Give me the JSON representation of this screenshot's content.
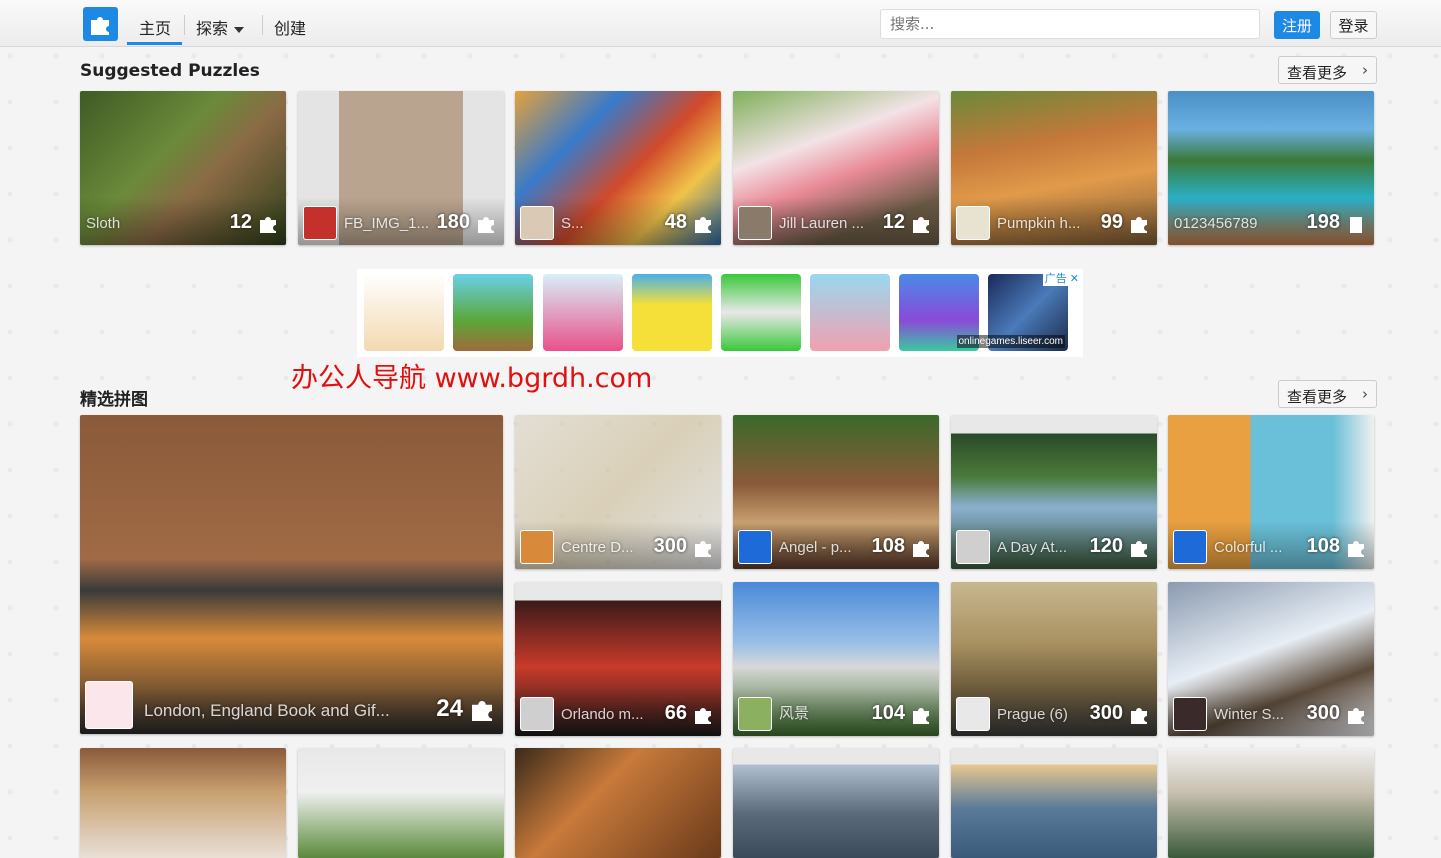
{
  "nav": {
    "home": "主页",
    "explore": "探索",
    "create": "创建",
    "search_placeholder": "搜索...",
    "register": "注册",
    "login": "登录"
  },
  "suggested": {
    "title": "Suggested Puzzles",
    "more": "查看更多",
    "tiles": [
      {
        "name": "Sloth",
        "count": "12"
      },
      {
        "name": "FB_IMG_1...",
        "count": "180"
      },
      {
        "name": "S...",
        "count": "48"
      },
      {
        "name": "Jill Lauren ...",
        "count": "12"
      },
      {
        "name": "Pumpkin h...",
        "count": "99"
      },
      {
        "name": "0123456789",
        "count": "198"
      }
    ]
  },
  "ad": {
    "tag": "广告 ✕",
    "caption": "onlinegames.liseer.com"
  },
  "watermark": "办公人导航 www.bgrdh.com",
  "featured": {
    "title": "精选拼图",
    "more": "查看更多",
    "big_tile": {
      "name": "London, England Book and Gif...",
      "count": "24"
    },
    "tiles": [
      {
        "name": "Centre D...",
        "count": "300"
      },
      {
        "name": "Angel - p...",
        "count": "108"
      },
      {
        "name": "A Day At...",
        "count": "120"
      },
      {
        "name": "Colorful ...",
        "count": "108"
      },
      {
        "name": "Orlando m...",
        "count": "66"
      },
      {
        "name": "风景",
        "count": "104"
      },
      {
        "name": "Prague (6)",
        "count": "300"
      },
      {
        "name": "Winter S...",
        "count": "300"
      }
    ]
  },
  "colors": {
    "accent": "#1e88e5"
  }
}
